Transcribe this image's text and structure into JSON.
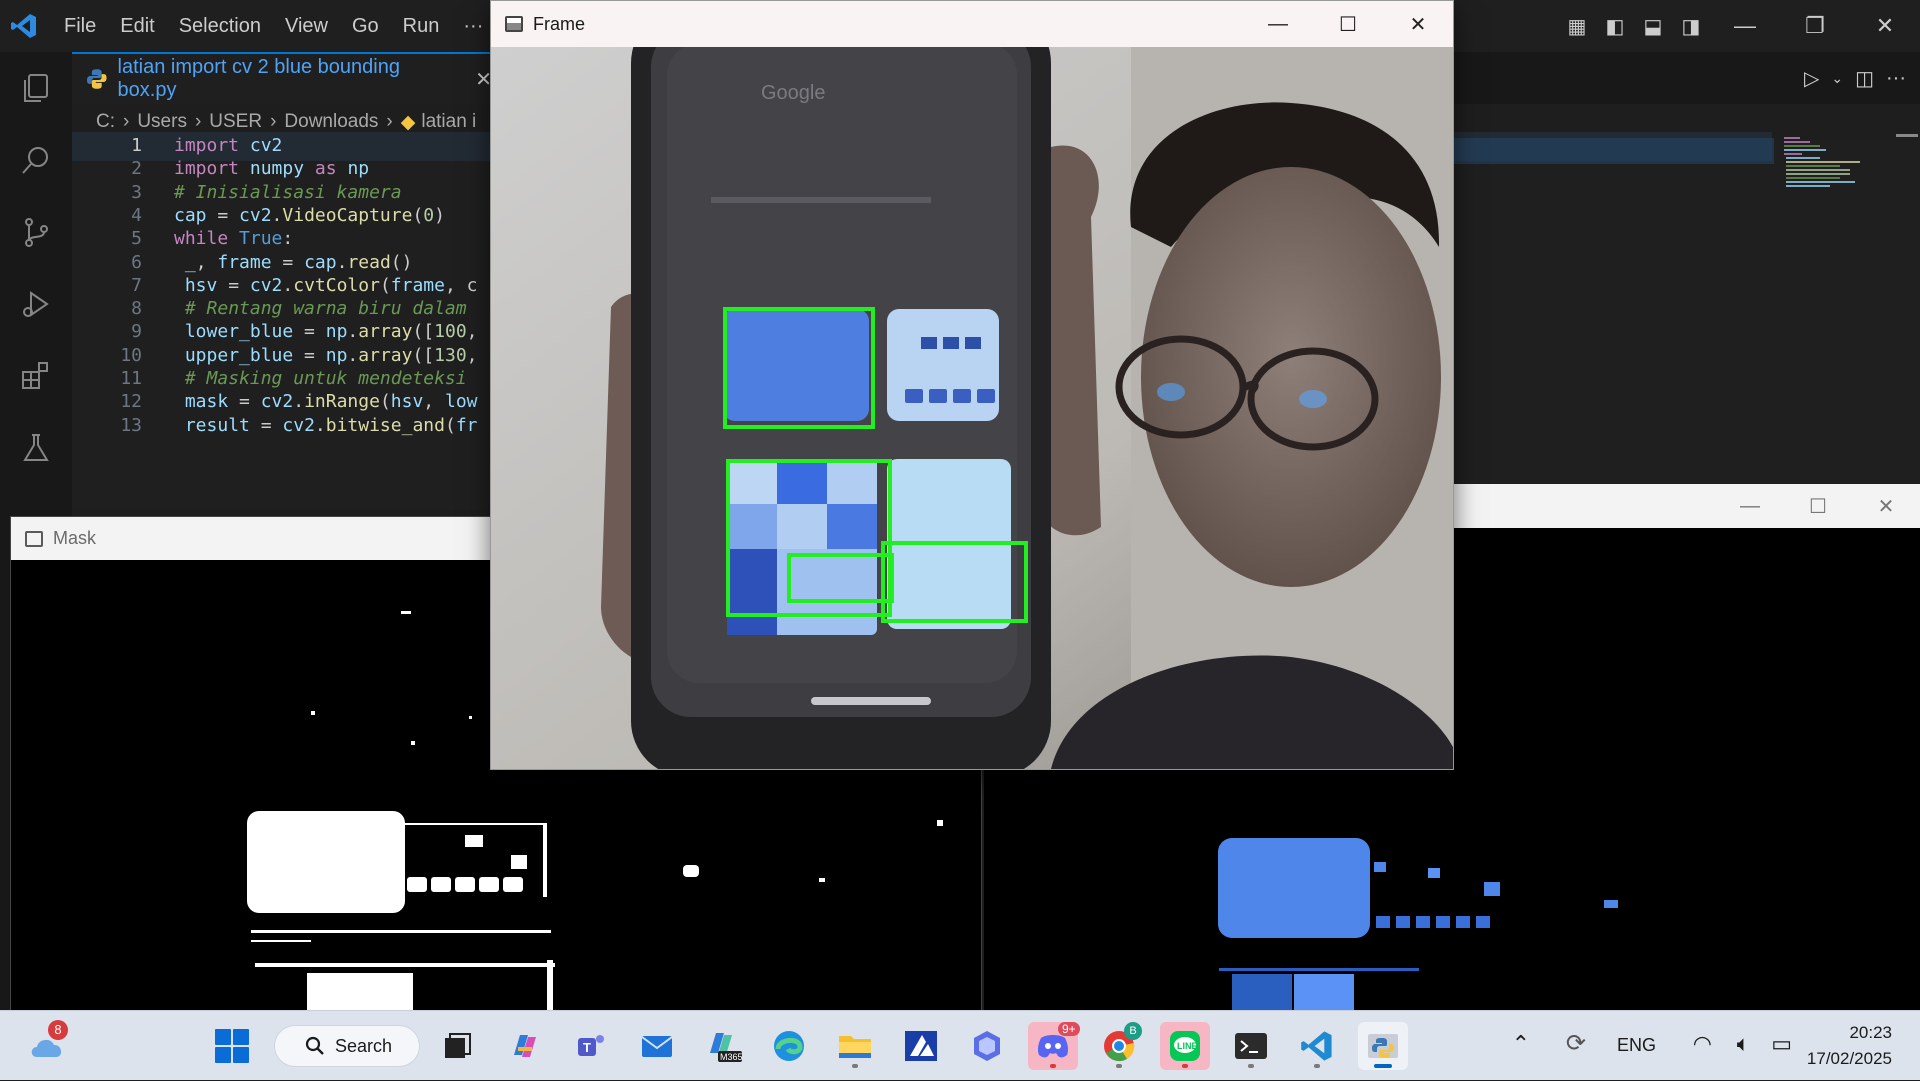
{
  "vscode": {
    "menu": [
      "File",
      "Edit",
      "Selection",
      "View",
      "Go",
      "Run",
      "···"
    ],
    "tab": {
      "filename": "latian import cv 2 blue bounding box.py",
      "close": "✕"
    },
    "breadcrumb": [
      "C:",
      "Users",
      "USER",
      "Downloads",
      "latian i"
    ],
    "code": [
      {
        "n": "1",
        "html": "<span class='kw'>import</span> <span class='var'>cv2</span>"
      },
      {
        "n": "2",
        "html": "<span class='kw'>import</span> <span class='var'>numpy</span> <span class='kw'>as</span> <span class='var'>np</span>"
      },
      {
        "n": "3",
        "html": "<span class='cm'># Inisialisasi kamera</span>"
      },
      {
        "n": "4",
        "html": "<span class='var'>cap</span> = <span class='var'>cv2</span>.<span class='fn'>VideoCapture</span>(<span class='num'>0</span>)"
      },
      {
        "n": "5",
        "html": "<span class='kw'>while</span> <span class='kw2'>True</span>:"
      },
      {
        "n": "6",
        "html": " <span class='var'>_</span>, <span class='var'>frame</span> = <span class='var'>cap</span>.<span class='fn'>read</span>()"
      },
      {
        "n": "7",
        "html": " <span class='var'>hsv</span> = <span class='var'>cv2</span>.<span class='fn'>cvtColor</span>(<span class='var'>frame</span>, c"
      },
      {
        "n": "8",
        "html": " <span class='cm'># Rentang warna biru dalam</span>"
      },
      {
        "n": "9",
        "html": " <span class='var'>lower_blue</span> = <span class='var'>np</span>.<span class='fn'>array</span>([<span class='num'>100</span>,"
      },
      {
        "n": "10",
        "html": " <span class='var'>upper_blue</span> = <span class='var'>np</span>.<span class='fn'>array</span>([<span class='num'>130</span>,"
      },
      {
        "n": "11",
        "html": " <span class='cm'># Masking untuk mendeteksi</span>"
      },
      {
        "n": "12",
        "html": " <span class='var'>mask</span> = <span class='var'>cv2</span>.<span class='fn'>inRange</span>(<span class='var'>hsv</span>, <span class='var'>low</span>"
      },
      {
        "n": "13",
        "html": " <span class='var'>result</span> = <span class='var'>cv2</span>.<span class='fn'>bitwise_and</span>(<span class='var'>fr</span>"
      }
    ]
  },
  "frame_window": {
    "title": "Frame",
    "minimize": "—",
    "maximize": "☐",
    "close": "✕"
  },
  "mask_window": {
    "title": "Mask"
  },
  "result_window": {
    "minimize": "—",
    "maximize": "☐",
    "close": "✕"
  },
  "taskbar": {
    "weather_badge": "8",
    "search_label": "Search",
    "discord_badge": "9+",
    "chrome_badge": "B",
    "language": "ENG",
    "time": "20:23",
    "date": "17/02/2025"
  },
  "colors": {
    "accent": "#0078d4",
    "bbox": "#22ee22",
    "mask_white": "#ffffff",
    "result_blue": "#4f86ea"
  }
}
